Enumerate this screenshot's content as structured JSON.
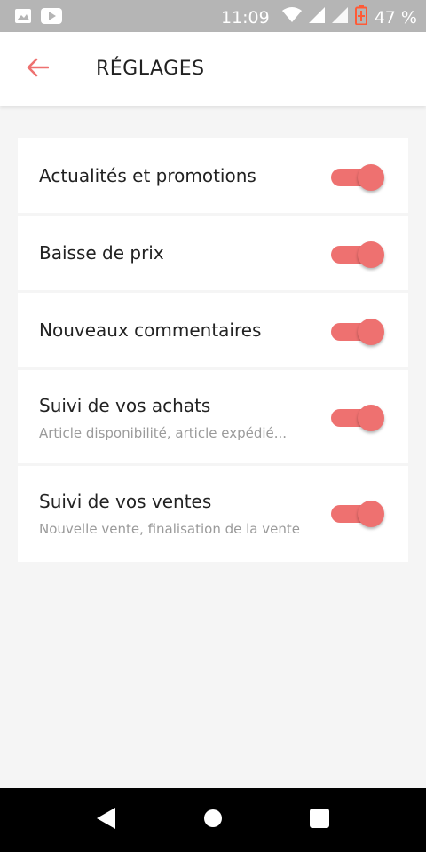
{
  "status_bar": {
    "time": "11:09",
    "battery": "47 %",
    "icons": [
      "image-icon",
      "youtube-icon",
      "wifi-icon",
      "signal-icon",
      "signal-icon",
      "battery-charging-icon"
    ]
  },
  "header": {
    "back_icon": "arrow-left-icon",
    "title": "RÉGLAGES"
  },
  "settings": [
    {
      "title": "Actualités et promotions",
      "subtitle": "",
      "enabled": true
    },
    {
      "title": "Baisse de prix",
      "subtitle": "",
      "enabled": true
    },
    {
      "title": "Nouveaux commentaires",
      "subtitle": "",
      "enabled": true
    },
    {
      "title": "Suivi de vos achats",
      "subtitle": "Article disponibilité, article expédié...",
      "enabled": true
    },
    {
      "title": "Suivi de vos ventes",
      "subtitle": "Nouvelle vente, finalisation de la vente",
      "enabled": true
    }
  ],
  "colors": {
    "accent": "#ee7170",
    "status_bar": "#b5b5b5",
    "background": "#f5f5f5",
    "nav_bar": "#000000"
  },
  "nav": {
    "icons": [
      "back-triangle-icon",
      "home-circle-icon",
      "recents-square-icon"
    ]
  }
}
